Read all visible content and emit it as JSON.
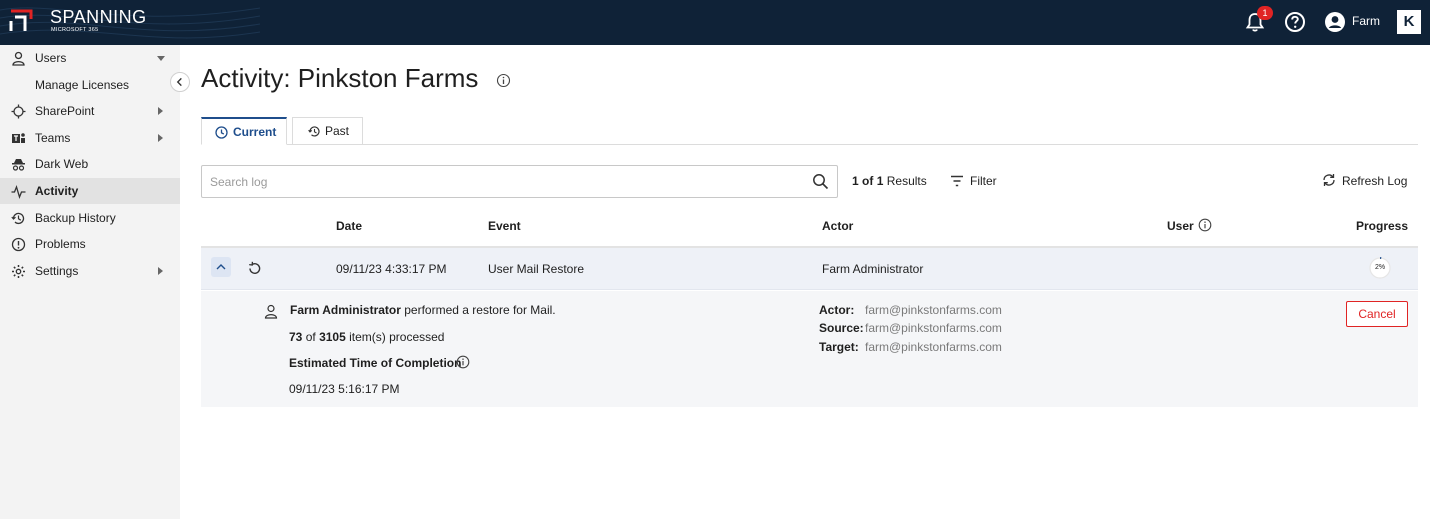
{
  "brand": {
    "name": "SPANNING",
    "product": "MICROSOFT 365"
  },
  "header": {
    "notification_count": "1",
    "user_name": "Farm",
    "vendor_mark": "K"
  },
  "sidebar": {
    "items": [
      {
        "label": "Users"
      },
      {
        "label": "Manage Licenses"
      },
      {
        "label": "SharePoint"
      },
      {
        "label": "Teams"
      },
      {
        "label": "Dark Web"
      },
      {
        "label": "Activity"
      },
      {
        "label": "Backup History"
      },
      {
        "label": "Problems"
      },
      {
        "label": "Settings"
      }
    ],
    "active": "Activity"
  },
  "page": {
    "title": "Activity: Pinkston Farms"
  },
  "tabs": [
    {
      "label": "Current"
    },
    {
      "label": "Past"
    }
  ],
  "toolbar": {
    "search_placeholder": "Search log",
    "results_current": "1",
    "results_of": "of",
    "results_total": "1",
    "results_label": "Results",
    "filter_label": "Filter",
    "refresh_label": "Refresh Log"
  },
  "table": {
    "columns": [
      "Date",
      "Event",
      "Actor",
      "User",
      "Progress"
    ],
    "rows": [
      {
        "date": "09/11/23 4:33:17 PM",
        "event": "User Mail Restore",
        "actor": "Farm Administrator",
        "progress_label": "2%",
        "progress": 0.02
      }
    ]
  },
  "detail": {
    "actor_name": "Farm Administrator",
    "summary_rest": "performed a restore for Mail.",
    "processed": "73",
    "processed_of": "of",
    "total": "3105",
    "items_label": "item(s) processed",
    "eta_label": "Estimated Time of Completion",
    "eta_value": "09/11/23 5:16:17 PM",
    "actor_key": "Actor:",
    "actor_value": "farm@pinkstonfarms.com",
    "source_key": "Source:",
    "source_value": "farm@pinkstonfarms.com",
    "target_key": "Target:",
    "target_value": "farm@pinkstonfarms.com",
    "cancel_label": "Cancel"
  },
  "colors": {
    "topbar": "#0f2237",
    "accent": "#1f4e8c",
    "danger": "#e02424",
    "sidebar_bg": "#f3f3f3",
    "row_bg": "#eef1f7"
  }
}
